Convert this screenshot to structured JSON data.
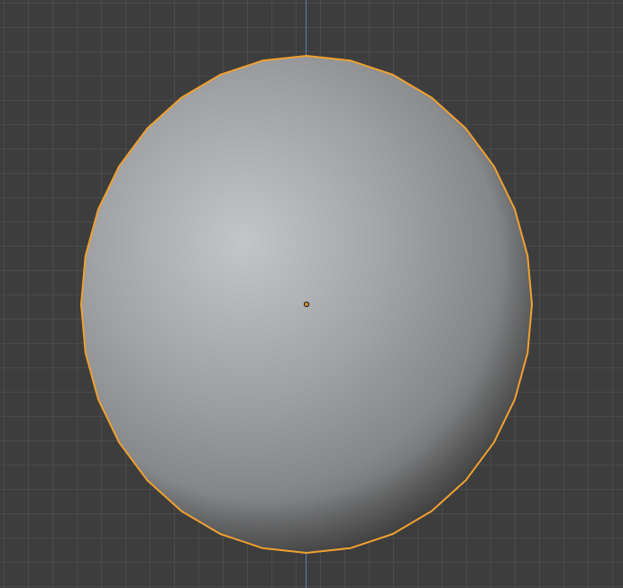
{
  "viewport": {
    "background_color": "#3d3d3d",
    "grid_line_color": "#4a4a4a",
    "axis_line_color": "#5b7fb3"
  },
  "object": {
    "shape": "sphere",
    "shading": "solid",
    "selected": true,
    "outline_color": "#f0a030",
    "origin_dot_color": "#f0a030",
    "surface_highlight_color": "#c3c5c7",
    "surface_mid_color": "#8e9093",
    "surface_shadow_color": "#4e4e4e"
  }
}
